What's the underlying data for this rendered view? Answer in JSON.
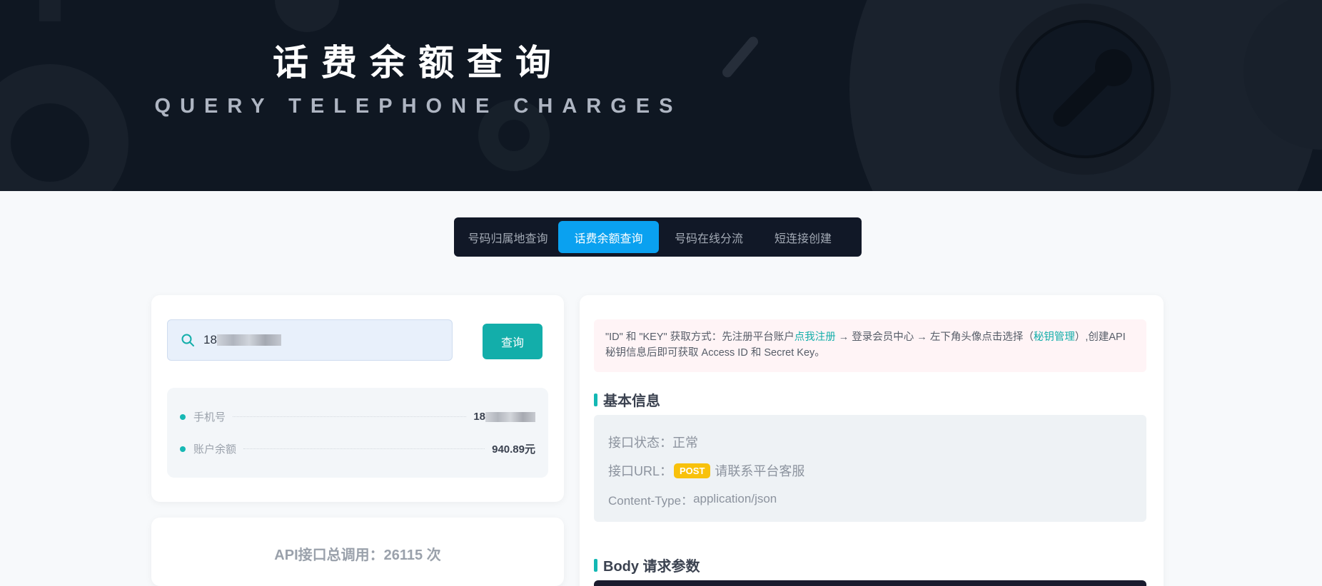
{
  "banner": {
    "title": "话费余额查询",
    "subtitle": "QUERY TELEPHONE CHARGES"
  },
  "tabs": [
    {
      "label": "号码归属地查询",
      "active": false
    },
    {
      "label": "话费余额查询",
      "active": true
    },
    {
      "label": "号码在线分流",
      "active": false
    },
    {
      "label": "短连接创建",
      "active": false
    }
  ],
  "search": {
    "value": "18",
    "icon": "search-icon",
    "button_label": "查询"
  },
  "result": {
    "phone_label": "手机号",
    "phone_value": "18",
    "balance_label": "账户余额",
    "balance_value": "940.89元"
  },
  "stats": {
    "text": "API接口总调用：26115 次"
  },
  "notice": {
    "part1": "\"ID\" 和 \"KEY\" 获取方式：先注册平台账户",
    "link1": "点我注册",
    "part2": " → 登录会员中心 → 左下角头像点击选择（",
    "link2": "秘钥管理",
    "part3": "）,创建API秘钥信息后即可获取 Access ID 和 Secret Key。"
  },
  "basic": {
    "heading": "基本信息",
    "status_label": "接口状态：",
    "status_value": "正常",
    "url_label": "接口URL：",
    "method": "POST",
    "url_value": "请联系平台客服",
    "content_type_label": "Content-Type：",
    "content_type_value": "application/json"
  },
  "body_params": {
    "heading": "Body 请求参数"
  },
  "colors": {
    "accent_teal": "#13aeaa",
    "tab_active": "#0aa1f0",
    "banner_bg": "#0f1722",
    "post_badge": "#f8c10c"
  }
}
